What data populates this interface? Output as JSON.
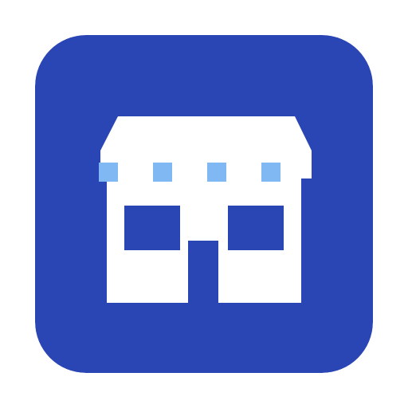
{
  "icon": {
    "name": "store-icon",
    "colors": {
      "background": "#2a46b5",
      "building": "#ffffff",
      "awning_dots": "#7fb8f3",
      "windows_door": "#2a46b5"
    }
  }
}
